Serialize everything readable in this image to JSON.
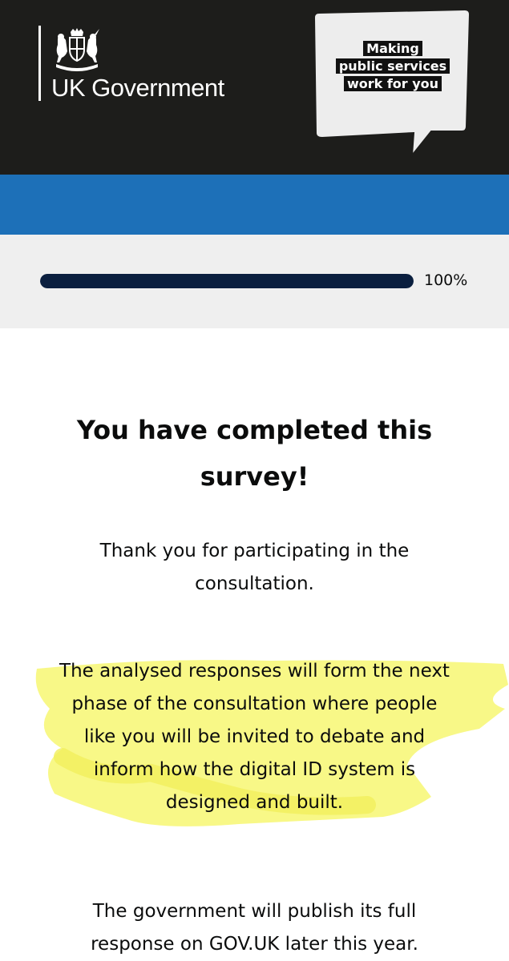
{
  "header": {
    "logo_text": "UK Government",
    "bubble_lines": [
      "Making",
      "public services",
      "work for you"
    ]
  },
  "progress": {
    "label": "100%",
    "value": 1.0
  },
  "main": {
    "title_line1": "You have completed this",
    "title_line2": "survey!",
    "paragraph1_line1": "Thank you for participating in the",
    "paragraph1_line2": "consultation.",
    "paragraph2_line1": "The analysed responses will form the next",
    "paragraph2_line2": "phase of the consultation where people",
    "paragraph2_line3": "like you will be invited to debate and",
    "paragraph2_line4": "inform how the digital ID system is",
    "paragraph2_line5": "designed and built.",
    "paragraph3_line1": "The government will publish its full",
    "paragraph3_line2": "response on GOV.UK later this year."
  },
  "colors": {
    "header_bg": "#1d1d1b",
    "blue_band": "#1d70b8",
    "progress_fill": "#0b1f3f",
    "progress_bg": "#efefef",
    "highlight": "#f7f77a"
  },
  "icons": {
    "crest": "royal-coat-of-arms-icon",
    "bubble": "speech-bubble-icon"
  }
}
